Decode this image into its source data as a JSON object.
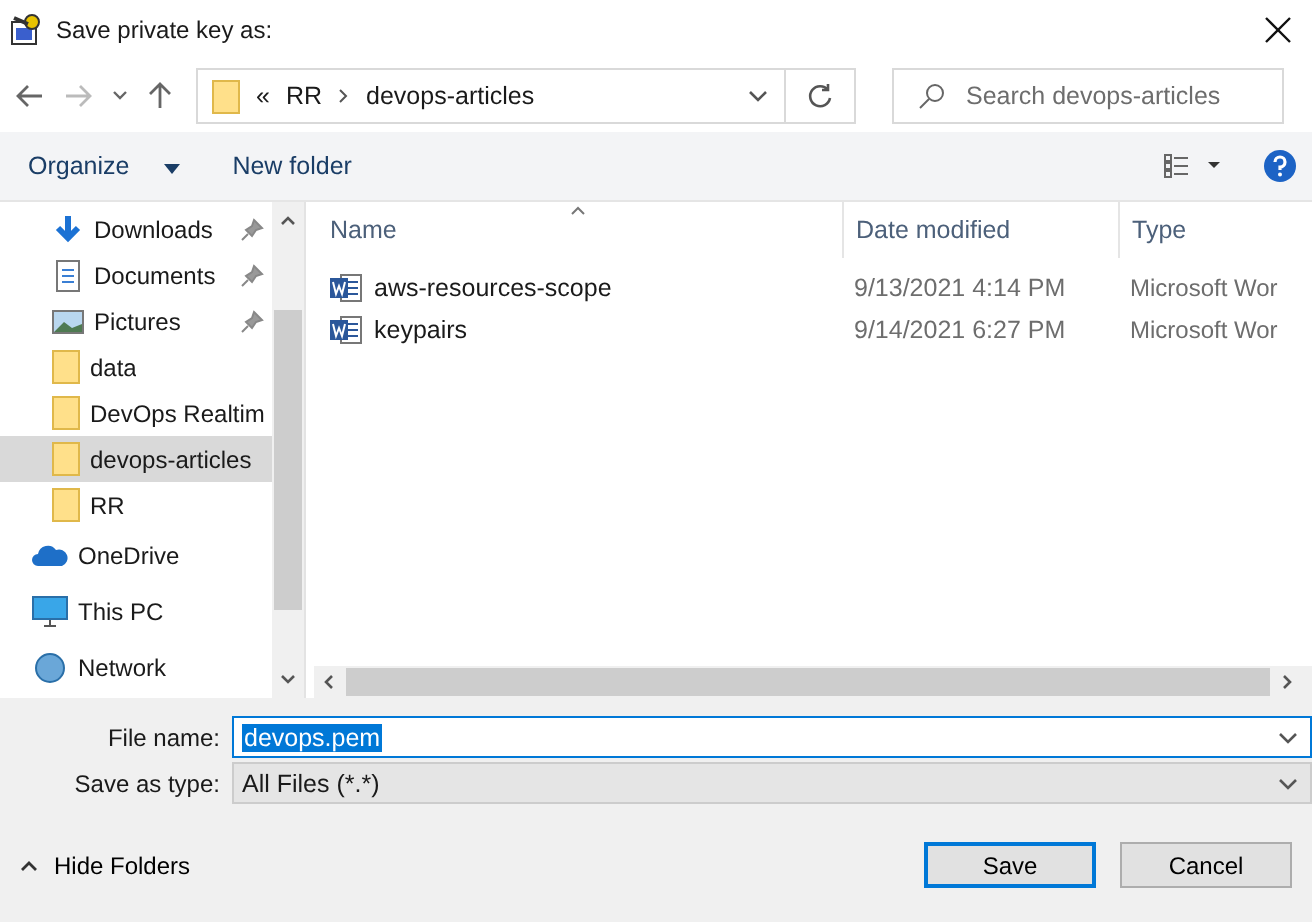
{
  "window": {
    "title": "Save private key as:"
  },
  "address": {
    "overflow": "«",
    "path": [
      "RR",
      "devops-articles"
    ]
  },
  "search": {
    "placeholder": "Search devops-articles"
  },
  "toolbar": {
    "organize": "Organize",
    "new_folder": "New folder"
  },
  "sidebar": {
    "items": [
      {
        "label": "Downloads",
        "kind": "downloads",
        "pinned": true,
        "selected": false
      },
      {
        "label": "Documents",
        "kind": "documents",
        "pinned": true,
        "selected": false
      },
      {
        "label": "Pictures",
        "kind": "pictures",
        "pinned": true,
        "selected": false
      },
      {
        "label": "data",
        "kind": "folder",
        "pinned": false,
        "selected": false
      },
      {
        "label": "DevOps Realtim",
        "kind": "folder",
        "pinned": false,
        "selected": false
      },
      {
        "label": "devops-articles",
        "kind": "folder",
        "pinned": false,
        "selected": true
      },
      {
        "label": "RR",
        "kind": "folder",
        "pinned": false,
        "selected": false
      },
      {
        "label": "OneDrive",
        "kind": "onedrive",
        "pinned": false,
        "selected": false
      },
      {
        "label": "This PC",
        "kind": "pc",
        "pinned": false,
        "selected": false
      },
      {
        "label": "Network",
        "kind": "network",
        "pinned": false,
        "selected": false
      }
    ]
  },
  "table": {
    "columns": [
      "Name",
      "Date modified",
      "Type"
    ],
    "rows": [
      {
        "name": "aws-resources-scope",
        "date": "9/13/2021 4:14 PM",
        "type": "Microsoft Wor"
      },
      {
        "name": "keypairs",
        "date": "9/14/2021 6:27 PM",
        "type": "Microsoft Wor"
      }
    ]
  },
  "file_name": {
    "label": "File name:",
    "value": "devops.pem"
  },
  "save_as_type": {
    "label": "Save as type:",
    "value": "All Files (*.*)"
  },
  "hide_folders": "Hide Folders",
  "buttons": [
    "Save",
    "Cancel"
  ]
}
